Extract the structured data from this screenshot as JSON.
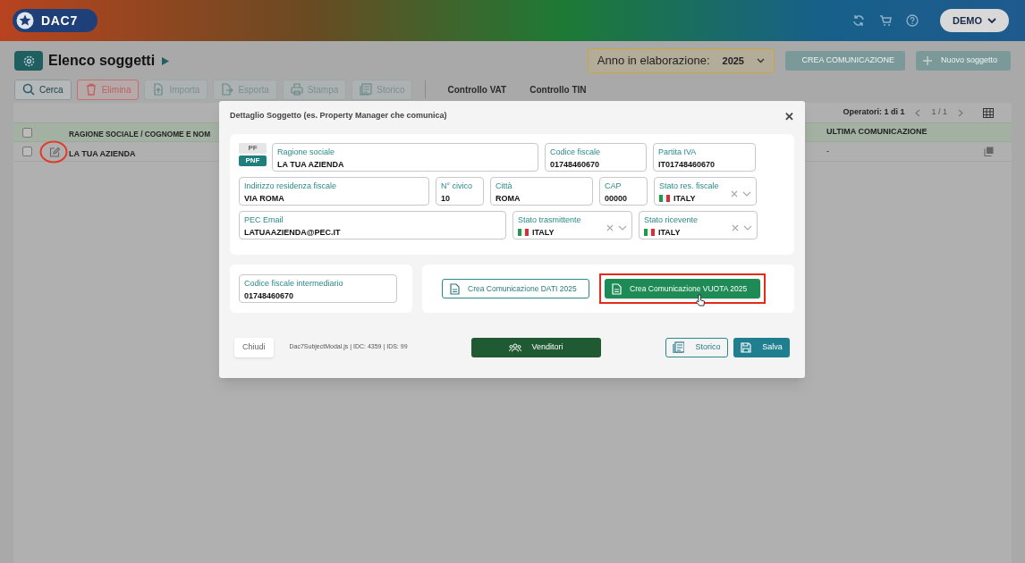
{
  "header": {
    "logo": "DAC7",
    "user_menu": "DEMO"
  },
  "page": {
    "title": "Elenco soggetti",
    "year_label": "Anno in elaborazione:",
    "year": "2025",
    "actions": [
      {
        "label": "CREA COMUNICAZIONE",
        "kind": "doc",
        "disabled": true
      },
      {
        "label": "Nuovo soggetto",
        "kind": "plus",
        "disabled": true
      }
    ]
  },
  "toolbar": [
    {
      "label": "Cerca",
      "kind": "search"
    },
    {
      "label": "Elimina",
      "kind": "trash"
    },
    {
      "label": "Importa",
      "kind": "import"
    },
    {
      "label": "Esporta",
      "kind": "export"
    },
    {
      "label": "Stampa",
      "kind": "print"
    },
    {
      "label": "Storico",
      "kind": "history"
    }
  ],
  "tabs": [
    {
      "label": "Controllo VAT"
    },
    {
      "label": "Controllo TIN"
    }
  ],
  "table": {
    "select_all": false,
    "operators": "Operatori: 1 di 1",
    "pager": "1 / 1",
    "columns": [
      "RAGIONE SOCIALE / COGNOME E NOM",
      "ULTIMA COMUNICAZIONE"
    ],
    "rows": [
      {
        "checked": false,
        "cells": [
          "LA TUA AZIENDA",
          "-"
        ]
      }
    ]
  },
  "modal": {
    "title": "Dettaglio Soggetto (es. Property Manager che comunica)",
    "close": "✕",
    "person_type": [
      {
        "label": "PF",
        "selected": false
      },
      {
        "label": "PNF",
        "selected": true
      }
    ],
    "field_rows": [
      [
        {
          "label": "Ragione sociale",
          "value": "LA TUA AZIENDA",
          "kind": "text"
        },
        {
          "label": "Codice fiscale",
          "value": "01748460670",
          "kind": "text"
        },
        {
          "label": "Partita IVA",
          "value": "IT01748460670",
          "kind": "text"
        }
      ],
      [
        {
          "label": "Indirizzo residenza fiscale",
          "value": "VIA ROMA",
          "kind": "text"
        },
        {
          "label": "N° civico",
          "value": "10",
          "kind": "text"
        },
        {
          "label": "Città",
          "value": "ROMA",
          "kind": "text"
        },
        {
          "label": "CAP",
          "value": "00000",
          "kind": "text"
        },
        {
          "label": "Stato res. fiscale",
          "value": "ITALY",
          "kind": "country"
        }
      ],
      [
        {
          "label": "PEC Email",
          "value": "LATUAAZIENDA@PEC.IT",
          "kind": "text"
        },
        {
          "label": "Stato trasmittente",
          "value": "ITALY",
          "kind": "country"
        },
        {
          "label": "Stato ricevente",
          "value": "ITALY",
          "kind": "country"
        }
      ]
    ],
    "intermediary": {
      "label": "Codice fiscale intermediario",
      "value": "01748460670"
    },
    "create_buttons": [
      {
        "label": "Crea Comunicazione DATI 2025",
        "kind": "outline",
        "highlighted": false
      },
      {
        "label": "Crea Comunicazione VUOTA 2025",
        "kind": "solid",
        "highlighted": true
      }
    ],
    "footer": {
      "close": "Chiudi",
      "info": "Dac7SubjectModal.js | IDC: 4359 | IDS: 99",
      "vendors": "Venditori",
      "history": "Storico",
      "save": "Salva"
    }
  }
}
